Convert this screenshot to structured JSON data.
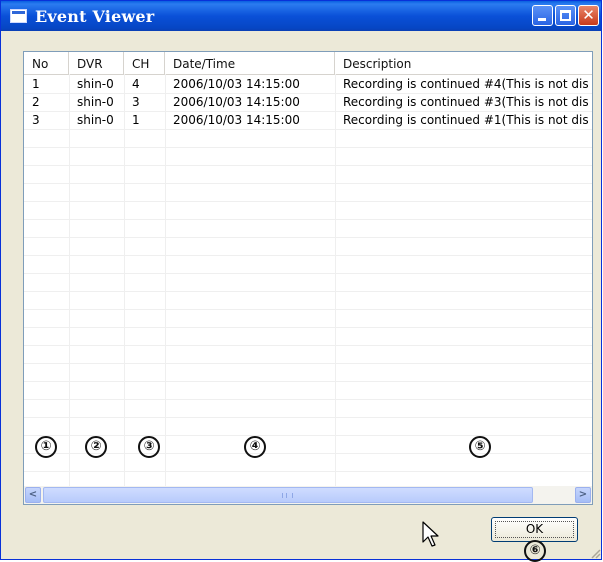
{
  "window": {
    "title": "Event Viewer",
    "icon": "window-app-icon",
    "minimize_icon": "minimize-icon",
    "maximize_icon": "maximize-icon",
    "close_icon": "close-icon",
    "close_glyph": "✕"
  },
  "list": {
    "columns": [
      "No",
      "DVR",
      "CH",
      "Date/Time",
      "Description"
    ],
    "rows": [
      {
        "no": "1",
        "dvr": "shin-0",
        "ch": "4",
        "datetime": "2006/10/03 14:15:00",
        "description": "Recording is continued #4(This is not dis"
      },
      {
        "no": "2",
        "dvr": "shin-0",
        "ch": "3",
        "datetime": "2006/10/03 14:15:00",
        "description": "Recording is continued #3(This is not dis"
      },
      {
        "no": "3",
        "dvr": "shin-0",
        "ch": "1",
        "datetime": "2006/10/03 14:15:00",
        "description": "Recording is continued #1(This is not dis"
      }
    ],
    "markers": [
      "①",
      "②",
      "③",
      "④",
      "⑤"
    ],
    "scroll_left_glyph": "<",
    "scroll_right_glyph": ">"
  },
  "ok_button": {
    "label": "OK",
    "marker": "⑥"
  },
  "colors": {
    "title_bar": "#0a50d8",
    "window_bg": "#ece9d8",
    "close_button": "#c83a1a"
  }
}
